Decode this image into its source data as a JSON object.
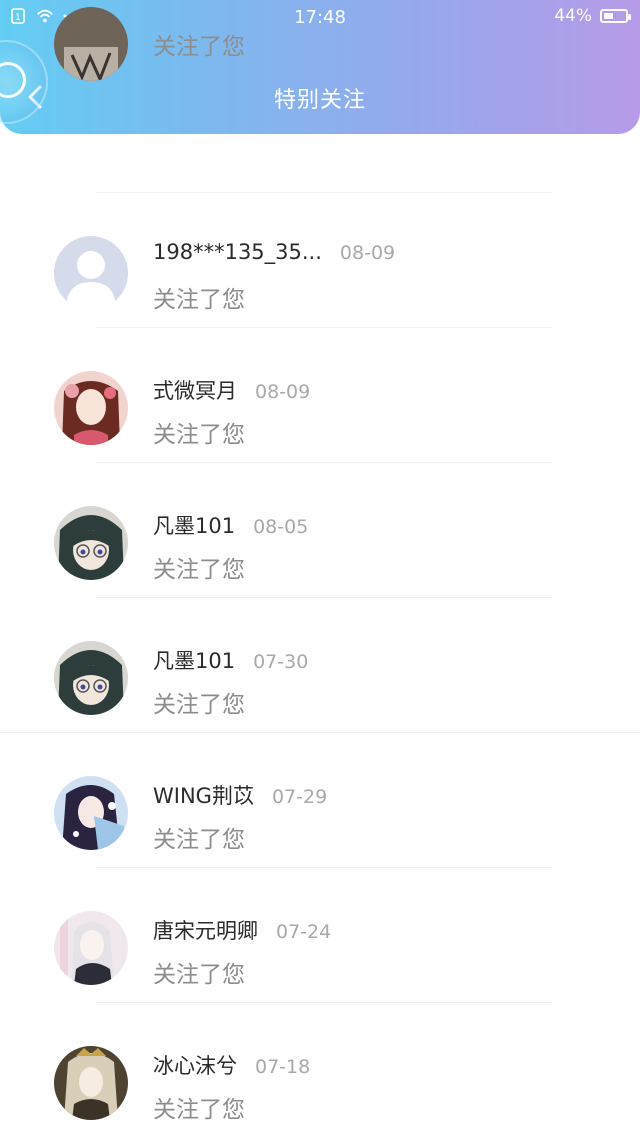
{
  "status_bar": {
    "time": "17:48",
    "battery_percent_text": "44%",
    "battery_level": 0.44,
    "icons": [
      "sim-icon",
      "wifi-icon",
      "more-dots-icon"
    ]
  },
  "header": {
    "title": "特别关注",
    "back_icon": "chevron-left-icon",
    "accent_gradient": [
      "#63cdf3",
      "#b79be8"
    ]
  },
  "floating_ball": {
    "icon": "floating-assist-ball-icon"
  },
  "list": {
    "action_text": "关注了您",
    "items": [
      {
        "name": "",
        "date": "",
        "action": "关注了您",
        "avatar": "anime-avatar-partial"
      },
      {
        "name": "198***135_35...",
        "date": "08-09",
        "action": "关注了您",
        "avatar": "default-user-avatar"
      },
      {
        "name": "式微冥月",
        "date": "08-09",
        "action": "关注了您",
        "avatar": "anime-girl-flowers-avatar"
      },
      {
        "name": "凡墨101",
        "date": "08-05",
        "action": "关注了您",
        "avatar": "anime-glasses-avatar"
      },
      {
        "name": "凡墨101",
        "date": "07-30",
        "action": "关注了您",
        "avatar": "anime-glasses-avatar"
      },
      {
        "name": "WING荆苡",
        "date": "07-29",
        "action": "关注了您",
        "avatar": "anime-girl-blue-avatar"
      },
      {
        "name": "唐宋元明卿",
        "date": "07-24",
        "action": "关注了您",
        "avatar": "anime-white-hair-avatar"
      },
      {
        "name": "冰心沫兮",
        "date": "07-18",
        "action": "关注了您",
        "avatar": "anime-gold-crown-avatar"
      }
    ]
  },
  "colors": {
    "name_text": "#2b2b2b",
    "date_text": "#a9a9a9",
    "action_text": "#8d8d8d",
    "divider": "#f0f0f0"
  }
}
